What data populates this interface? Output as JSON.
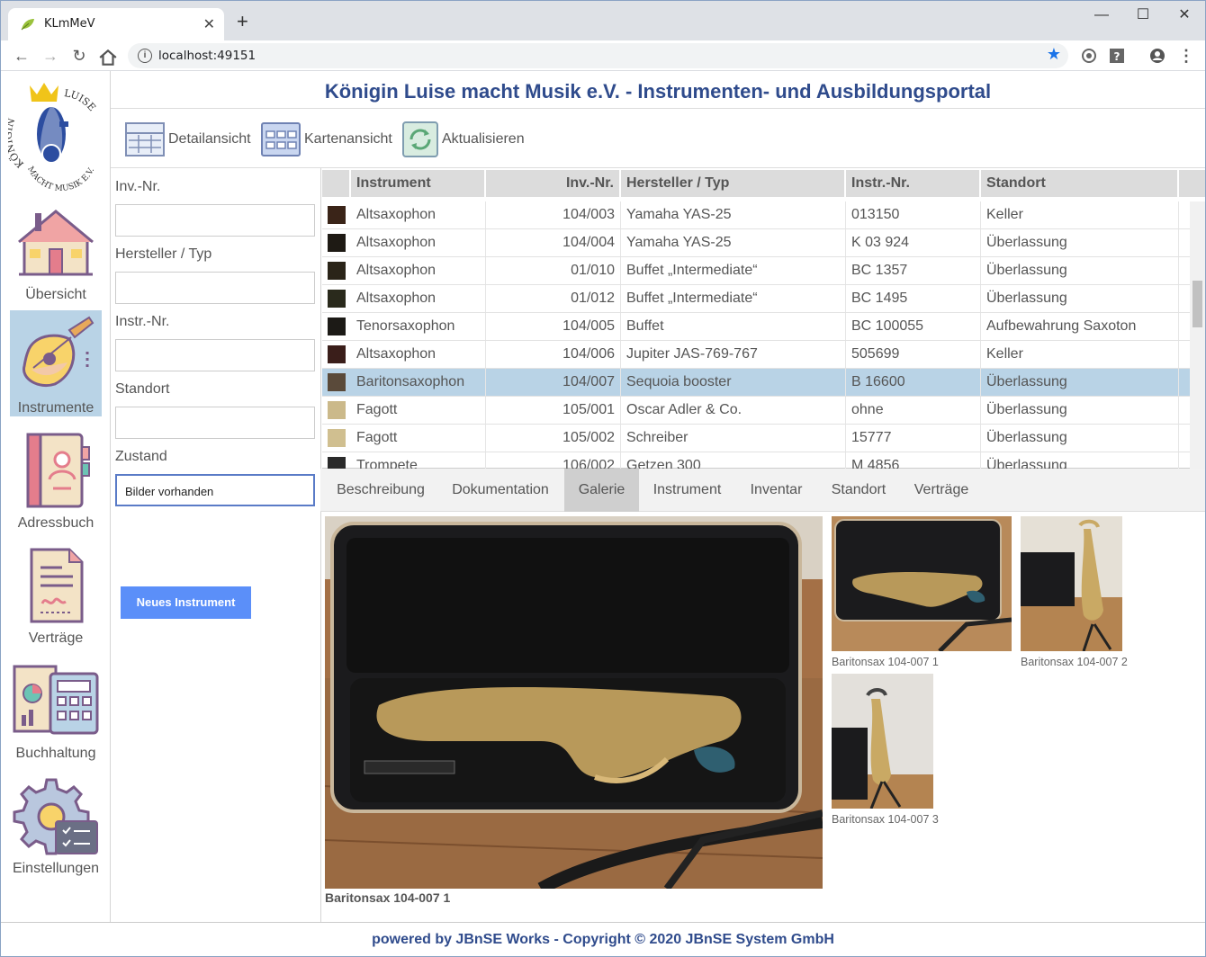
{
  "browser": {
    "tab_title": "KLmMeV",
    "new_tab": "+",
    "url": "localhost:49151",
    "window_controls": {
      "minimize": "—",
      "maximize": "☐",
      "close": "✕"
    }
  },
  "app": {
    "title": "Königin Luise macht Musik e.V. - Instrumenten- und Ausbildungsportal",
    "logo_text": "KÖNIGIN LUISE MACHT MUSIK E.V."
  },
  "sidebar": {
    "items": [
      {
        "label": "Übersicht",
        "icon": "house-icon",
        "active": false
      },
      {
        "label": "Instrumente",
        "icon": "mandolin-icon",
        "active": true
      },
      {
        "label": "Adressbuch",
        "icon": "address-book-icon",
        "active": false
      },
      {
        "label": "Verträge",
        "icon": "contract-icon",
        "active": false
      },
      {
        "label": "Buchhaltung",
        "icon": "accounting-icon",
        "active": false
      },
      {
        "label": "Einstellungen",
        "icon": "settings-icon",
        "active": false
      }
    ]
  },
  "actions": {
    "detail": "Detailansicht",
    "cards": "Kartenansicht",
    "refresh": "Aktualisieren"
  },
  "filters": {
    "inv_nr": "Inv.-Nr.",
    "hersteller": "Hersteller / Typ",
    "instr_nr": "Instr.-Nr.",
    "standort": "Standort",
    "zustand": "Zustand",
    "zustand_value": "Bilder vorhanden",
    "new_button": "Neues Instrument"
  },
  "grid": {
    "columns": [
      "Instrument",
      "Inv.-Nr.",
      "Hersteller / Typ",
      "Instr.-Nr.",
      "Standort"
    ],
    "rows": [
      {
        "instrument": "Altsaxophon",
        "inv": "104/003",
        "hersteller": "Yamaha YAS-25",
        "instr_nr": "013150",
        "standort": "Keller"
      },
      {
        "instrument": "Altsaxophon",
        "inv": "104/004",
        "hersteller": "Yamaha YAS-25",
        "instr_nr": "K 03 924",
        "standort": "Überlassung"
      },
      {
        "instrument": "Altsaxophon",
        "inv": "01/010",
        "hersteller": "Buffet „Intermediate“",
        "instr_nr": "BC 1357",
        "standort": "Überlassung"
      },
      {
        "instrument": "Altsaxophon",
        "inv": "01/012",
        "hersteller": "Buffet „Intermediate“",
        "instr_nr": "BC 1495",
        "standort": "Überlassung"
      },
      {
        "instrument": "Tenorsaxophon",
        "inv": "104/005",
        "hersteller": "Buffet",
        "instr_nr": "BC 100055",
        "standort": "Aufbewahrung Saxoton"
      },
      {
        "instrument": "Altsaxophon",
        "inv": "104/006",
        "hersteller": "Jupiter JAS-769-767",
        "instr_nr": "505699",
        "standort": "Keller"
      },
      {
        "instrument": "Baritonsaxophon",
        "inv": "104/007",
        "hersteller": "Sequoia booster",
        "instr_nr": "B 16600",
        "standort": "Überlassung"
      },
      {
        "instrument": "Fagott",
        "inv": "105/001",
        "hersteller": "Oscar Adler & Co.",
        "instr_nr": "ohne",
        "standort": "Überlassung"
      },
      {
        "instrument": "Fagott",
        "inv": "105/002",
        "hersteller": "Schreiber",
        "instr_nr": "15777",
        "standort": "Überlassung"
      },
      {
        "instrument": "Trompete",
        "inv": "106/002",
        "hersteller": "Getzen 300",
        "instr_nr": "M 4856",
        "standort": "Überlassung"
      }
    ]
  },
  "detail_tabs": [
    "Beschreibung",
    "Dokumentation",
    "Galerie",
    "Instrument",
    "Inventar",
    "Standort",
    "Verträge"
  ],
  "gallery": {
    "main_caption": "Baritonsax 104-007 1",
    "thumbs": [
      "Baritonsax 104-007 1",
      "Baritonsax 104-007 2",
      "Baritonsax 104-007 3"
    ]
  },
  "footer": "powered by JBnSE Works - Copyright © 2020 JBnSE System GmbH"
}
